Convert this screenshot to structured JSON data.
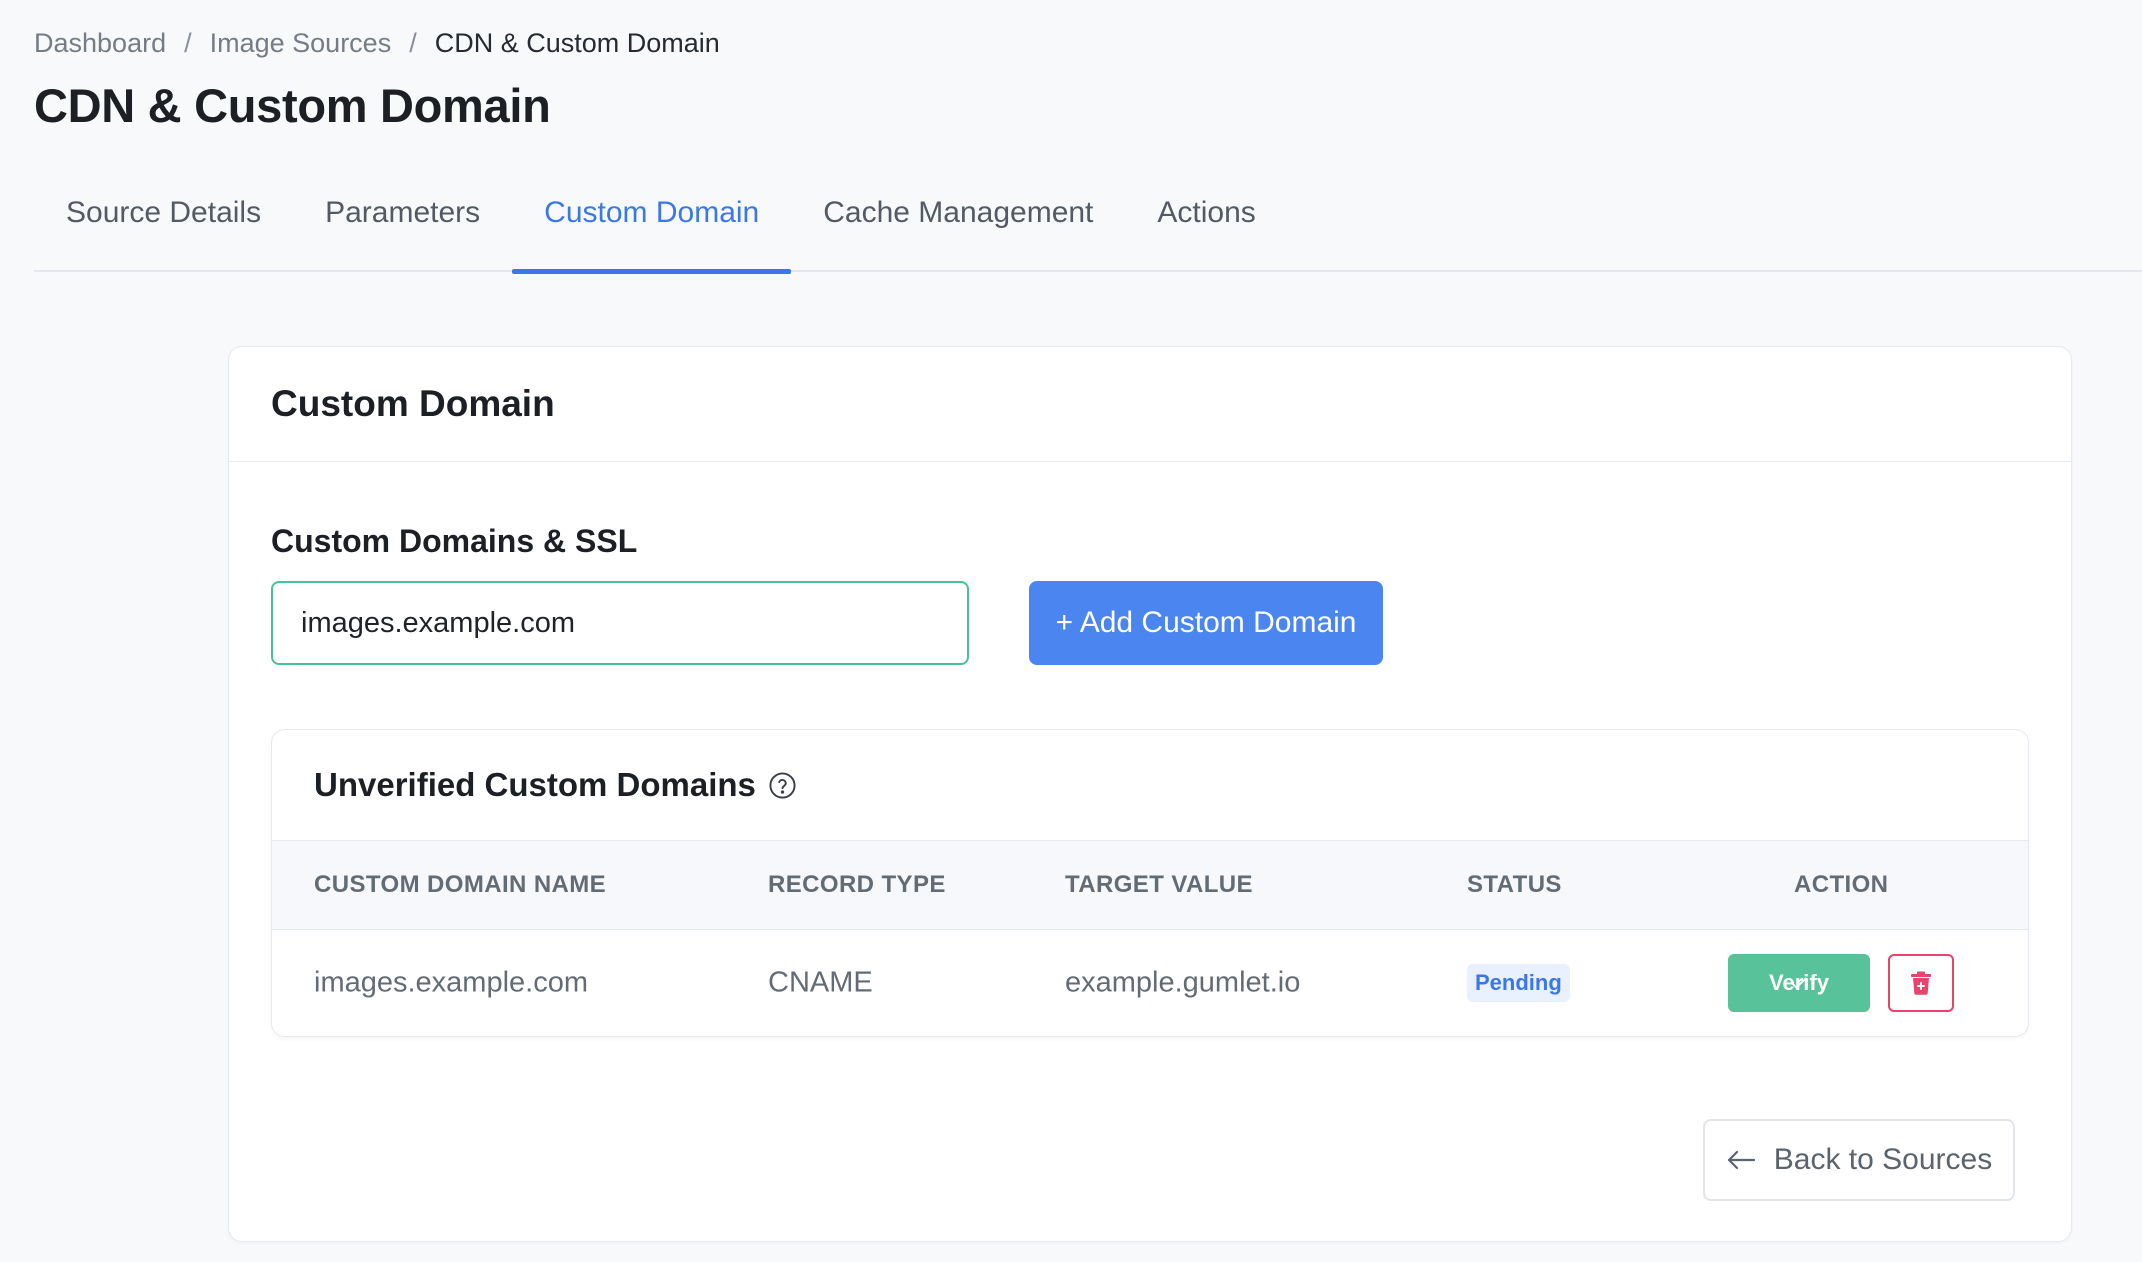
{
  "breadcrumb": {
    "items": [
      "Dashboard",
      "Image Sources"
    ],
    "separator": "/",
    "current": "CDN & Custom Domain"
  },
  "page_title": "CDN & Custom Domain",
  "tabs": [
    {
      "label": "Source Details",
      "active": false
    },
    {
      "label": "Parameters",
      "active": false
    },
    {
      "label": "Custom Domain",
      "active": true
    },
    {
      "label": "Cache Management",
      "active": false
    },
    {
      "label": "Actions",
      "active": false
    }
  ],
  "card": {
    "title": "Custom Domain",
    "section_label": "Custom Domains & SSL",
    "domain_input": {
      "value": "images.example.com"
    },
    "add_button_label": "+ Add Custom Domain"
  },
  "unverified": {
    "title": "Unverified Custom Domains",
    "help_icon": "question-circle-icon",
    "columns": [
      "CUSTOM DOMAIN NAME",
      "RECORD TYPE",
      "TARGET VALUE",
      "STATUS",
      "ACTION"
    ],
    "rows": [
      {
        "domain": "images.example.com",
        "record_type": "CNAME",
        "target": "example.gumlet.io",
        "status": "Pending",
        "verify_label": "Verify"
      }
    ]
  },
  "back_button_label": "Back to Sources",
  "colors": {
    "accent": "#3b78e7",
    "primary_button": "#4a85f0",
    "success": "#58c39a",
    "danger": "#e5446d",
    "input_focus_border": "#45c493"
  }
}
